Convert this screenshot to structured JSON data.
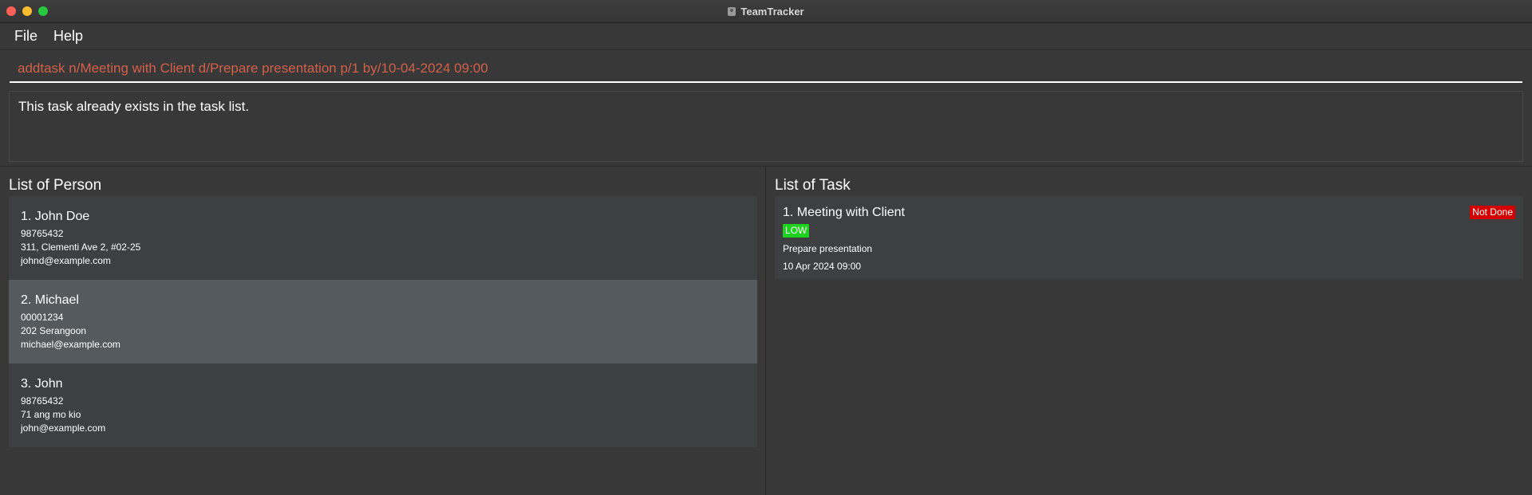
{
  "window": {
    "title": "TeamTracker"
  },
  "menu": {
    "file": "File",
    "help": "Help"
  },
  "command": {
    "value": "addtask n/Meeting with Client d/Prepare presentation p/1 by/10-04-2024 09:00"
  },
  "result": {
    "message": "This task already exists in the task list."
  },
  "persons": {
    "title": "List of Person",
    "items": [
      {
        "name": "1.  John Doe",
        "phone": "98765432",
        "address": "311, Clementi Ave 2, #02-25",
        "email": "johnd@example.com"
      },
      {
        "name": "2.  Michael",
        "phone": "00001234",
        "address": "202 Serangoon",
        "email": "michael@example.com"
      },
      {
        "name": "3.  John",
        "phone": "98765432",
        "address": "71 ang mo kio",
        "email": "john@example.com"
      }
    ]
  },
  "tasks": {
    "title": "List of Task",
    "items": [
      {
        "name": "1. Meeting with Client",
        "status": "Not Done",
        "priority": "LOW",
        "description": "Prepare presentation",
        "deadline": "10 Apr 2024 09:00"
      }
    ]
  },
  "colors": {
    "background": "#383838",
    "command_text": "#d1604a",
    "status_not_done": "#d40000",
    "priority_low": "#1ed11e",
    "selected_row": "#545a5e"
  }
}
